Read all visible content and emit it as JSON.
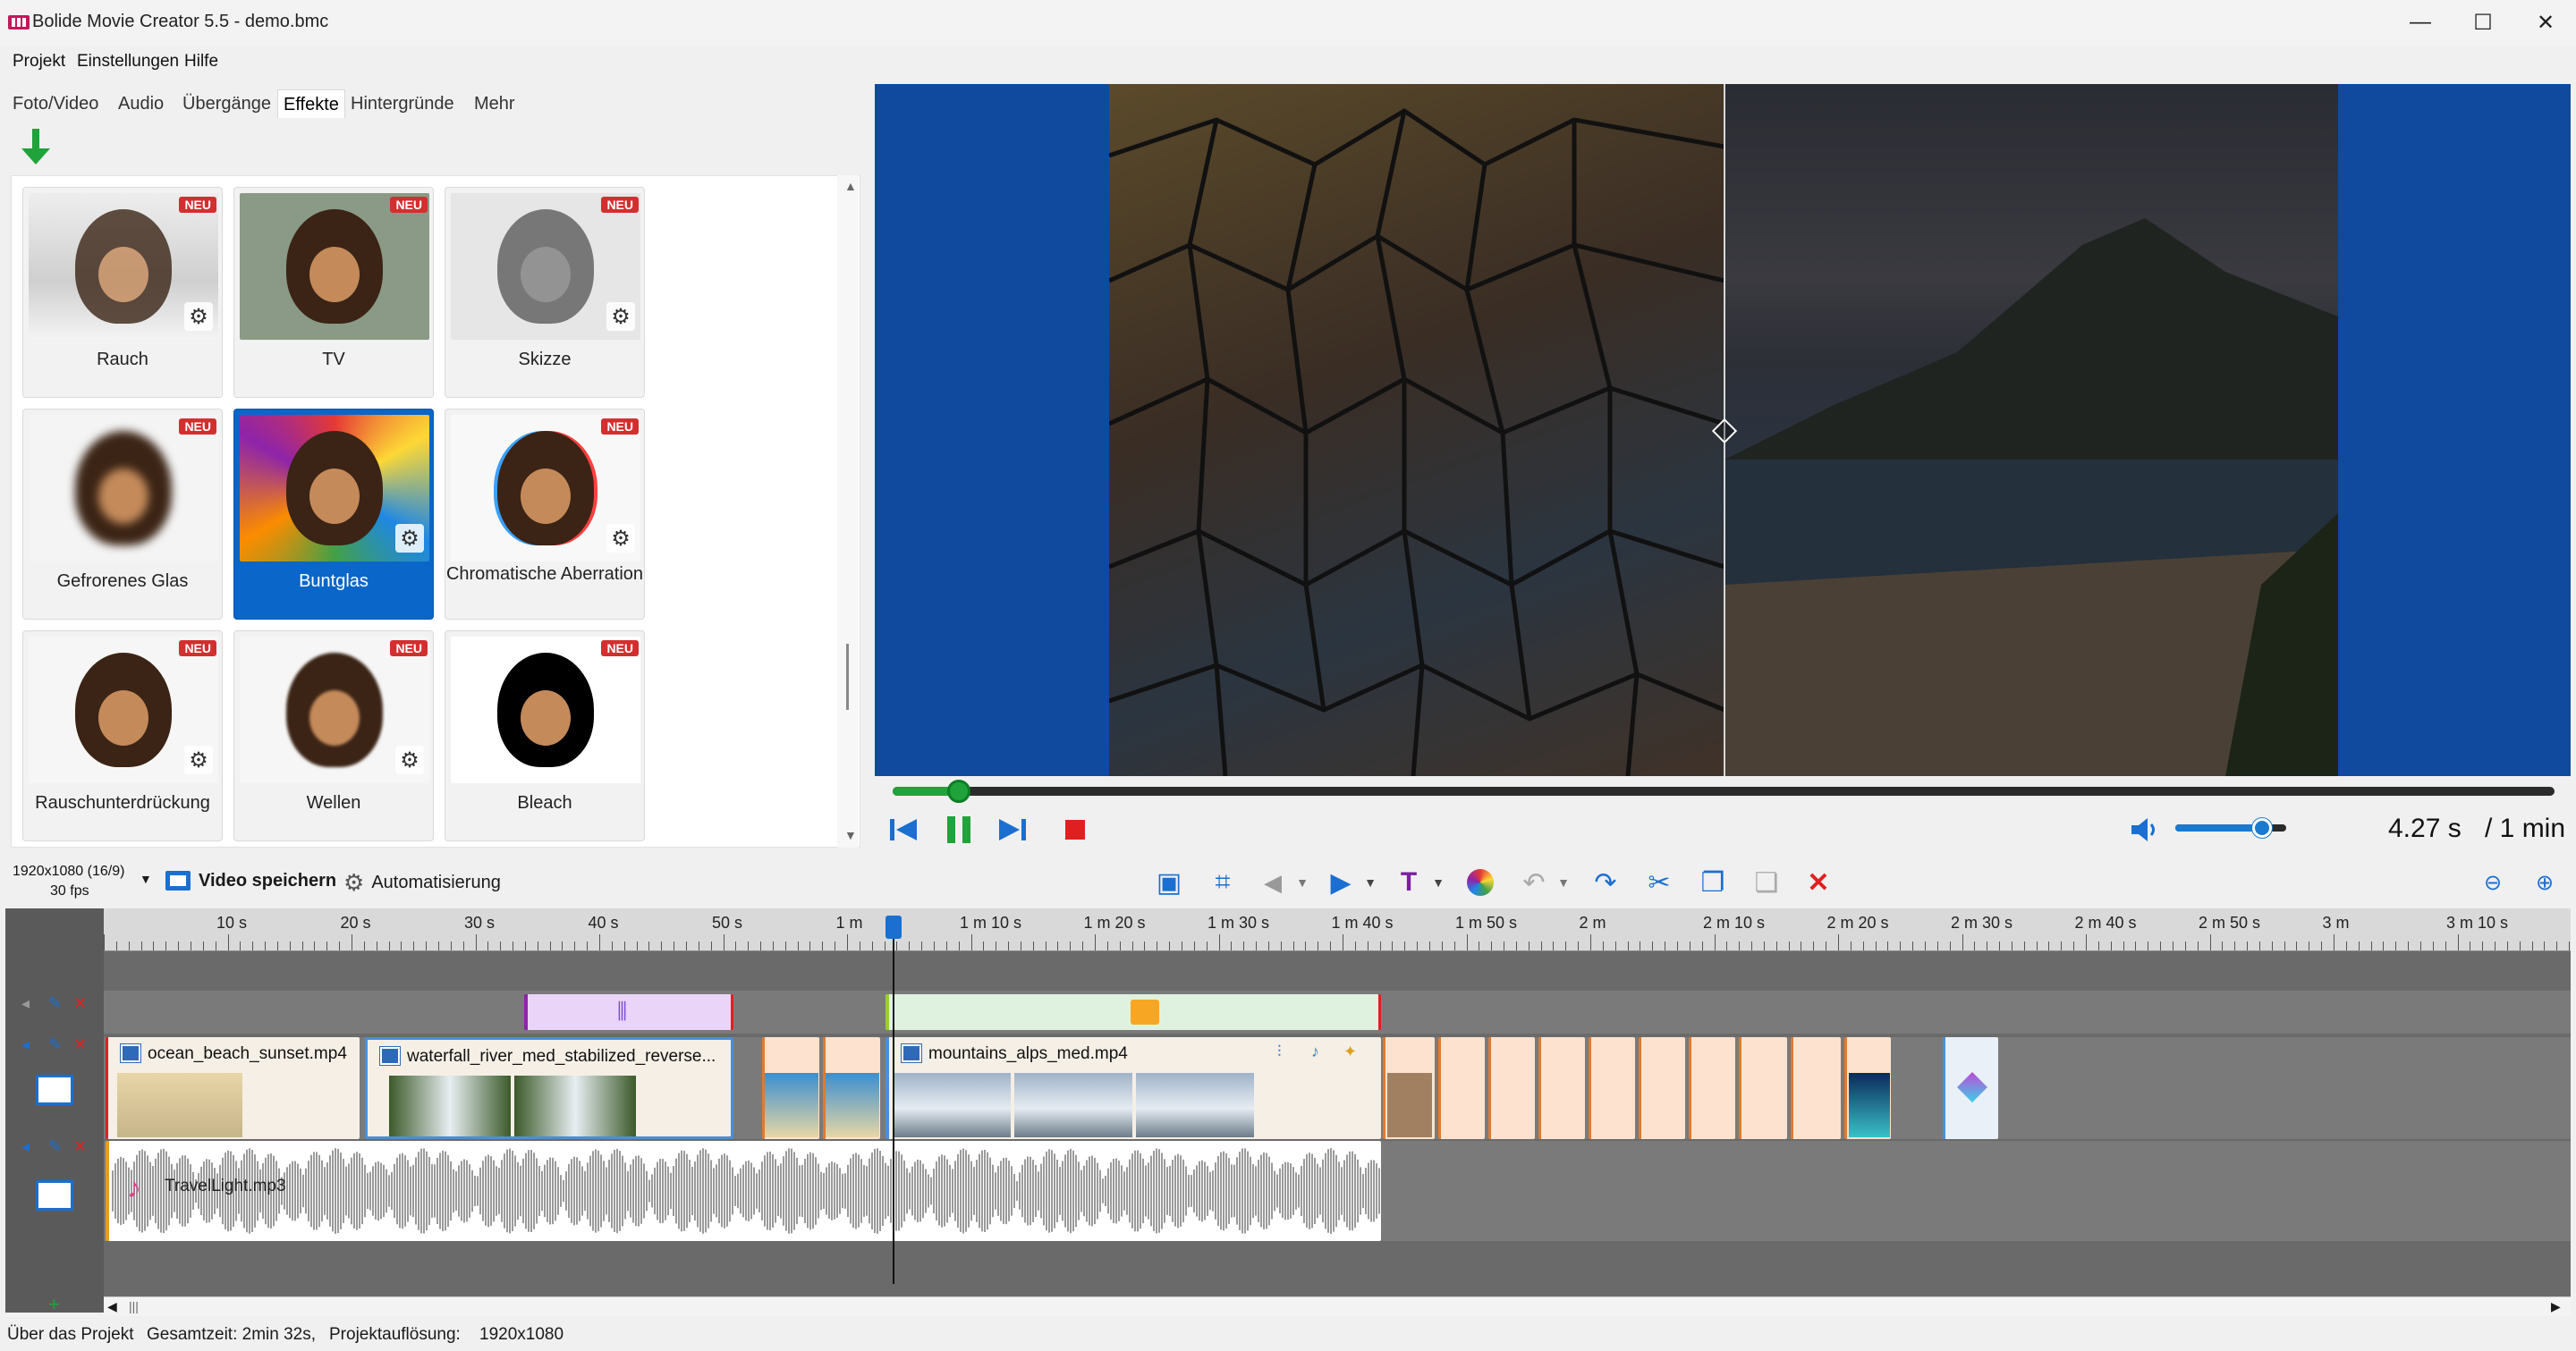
{
  "window": {
    "title": "Bolide Movie Creator 5.5 - demo.bmc",
    "minimize_glyph": "—",
    "maximize_glyph": "☐",
    "close_glyph": "✕"
  },
  "menu": [
    "Projekt",
    "Einstellungen",
    "Hilfe"
  ],
  "tabs": [
    "Foto/Video",
    "Audio",
    "Übergänge",
    "Effekte",
    "Hintergründe",
    "Mehr"
  ],
  "active_tab": "Effekte",
  "effects": [
    {
      "label": "Rauch",
      "new": true,
      "settings": true
    },
    {
      "label": "TV",
      "new": true,
      "settings": false
    },
    {
      "label": "Skizze",
      "new": true,
      "settings": true
    },
    {
      "label": "Gefrorenes Glas",
      "new": true,
      "settings": false
    },
    {
      "label": "Buntglas",
      "new": false,
      "settings": true,
      "selected": true
    },
    {
      "label": "Chromatische Aberration",
      "new": true,
      "settings": true
    },
    {
      "label": "Rauschunterdrückung",
      "new": true,
      "settings": true
    },
    {
      "label": "Wellen",
      "new": true,
      "settings": true
    },
    {
      "label": "Bleach",
      "new": true,
      "settings": false
    }
  ],
  "badge_text": "NEU",
  "player": {
    "current_time": "4.27 s",
    "total_time": "/ 1 min",
    "progress": 0.04,
    "volume": 0.78
  },
  "toolbar": {
    "resolution": "1920x1080 (16/9)",
    "fps": "30 fps",
    "save_video": "Video speichern",
    "automation": "Automatisierung"
  },
  "ruler_labels": [
    "10 s",
    "20 s",
    "30 s",
    "40 s",
    "50 s",
    "1 m",
    "1 m 10 s",
    "1 m 20 s",
    "1 m 30 s",
    "1 m 40 s",
    "1 m 50 s",
    "2 m",
    "2 m 10 s",
    "2 m 20 s",
    "2 m 30 s",
    "2 m 40 s",
    "2 m 50 s",
    "3 m",
    "3 m 10 s"
  ],
  "clips": {
    "ocean": "ocean_beach_sunset.mp4",
    "waterfall": "waterfall_river_med_stabilized_reverse...",
    "mountains": "mountains_alps_med.mp4",
    "audio": "TravelLight.mp3"
  },
  "status": {
    "about": "Über das Projekt",
    "total_time": "Gesamtzeit: 2min 32s,",
    "resolution_label": "Projektauflösung:",
    "resolution_value": "1920x1080"
  },
  "colors": {
    "accent_green": "#1fa33a",
    "selection_blue": "#0a66c8",
    "badge_red": "#d32f2f",
    "delete_red": "#e02020"
  }
}
